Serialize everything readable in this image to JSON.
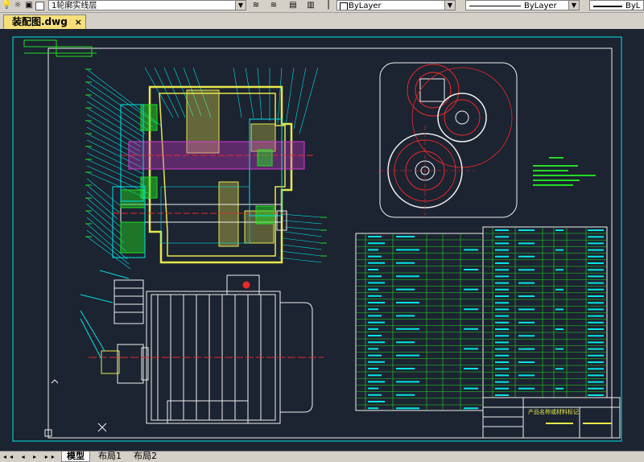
{
  "toolbar": {
    "layer_name": "1轮廓实线层",
    "color_value": "ByLayer",
    "linetype_value": "ByLayer",
    "lineweight_value": "ByL"
  },
  "document_tab": {
    "title": "装配图.dwg",
    "close": "×"
  },
  "drawing": {
    "title_block_name": "产品名称或材料标记",
    "bg_color": "#1c2331",
    "colors": {
      "cyan": "#00e5e5",
      "yellow": "#e8e84a",
      "green": "#22dd22",
      "red": "#e82a2a",
      "white": "#f0f0f0",
      "magenta": "#d43ad4"
    }
  },
  "layout_tabs": {
    "nav": "◂◂ ◂ ▸ ▸▸",
    "model": "模型",
    "layout1": "布局1",
    "layout2": "布局2"
  }
}
